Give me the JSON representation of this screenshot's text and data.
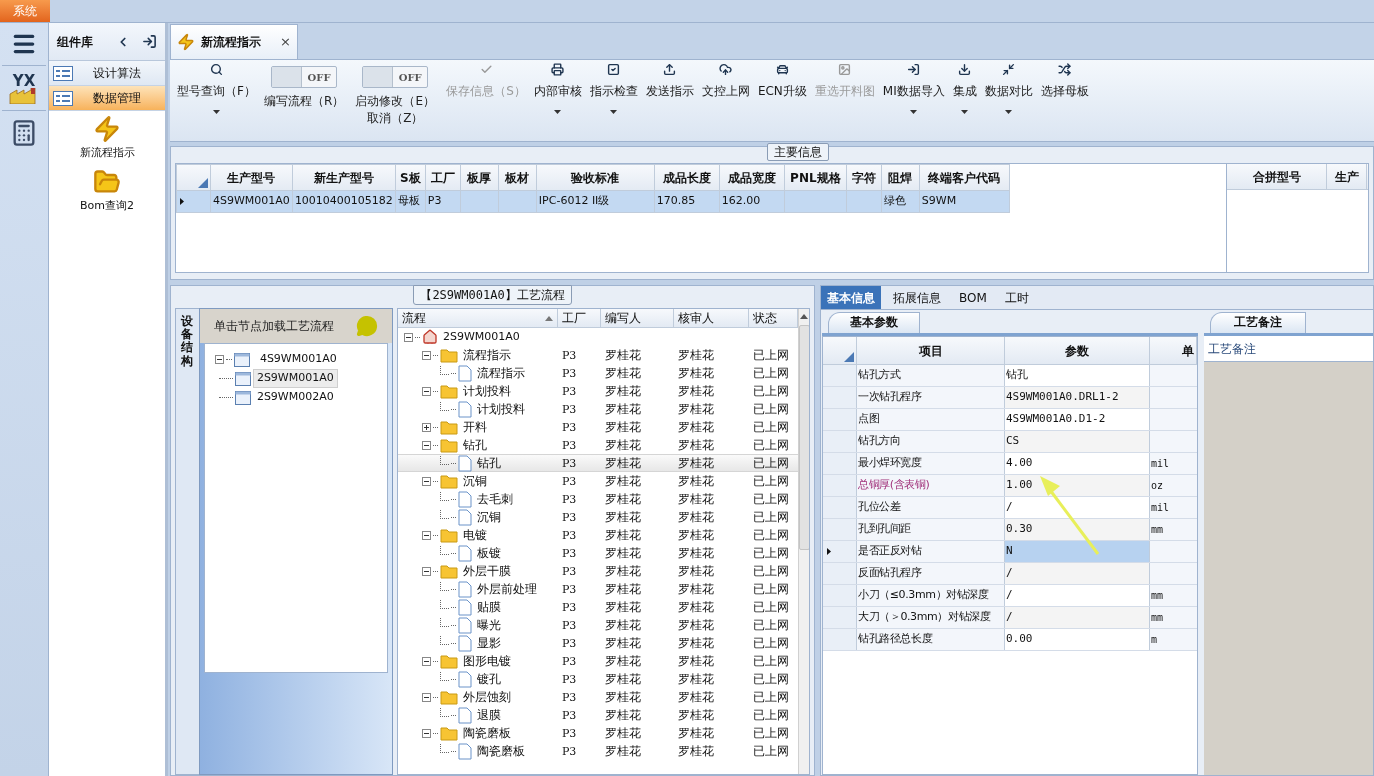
{
  "system_menu": "系统",
  "app_logo": "YX",
  "component_panel": {
    "title": "组件库",
    "items": [
      {
        "label": "设计算法",
        "selected": false
      },
      {
        "label": "数据管理",
        "selected": true
      }
    ],
    "tools": [
      {
        "label": "新流程指示",
        "kind": "lightning"
      },
      {
        "label": "Bom查询2",
        "kind": "folder"
      }
    ]
  },
  "document_tab": {
    "title": "新流程指示",
    "close": "×"
  },
  "toolbar": [
    {
      "kind": "button",
      "label": "型号查询（F）",
      "dropdown": true,
      "disabled": false
    },
    {
      "kind": "toggle",
      "label": "编写流程（R）",
      "switch_text": "OFF",
      "on": false
    },
    {
      "kind": "toggle",
      "label": "启动修改（E）取消（Z）",
      "switch_text": "OFF",
      "on": false
    },
    {
      "kind": "button",
      "label": "保存信息（S）",
      "dropdown": false,
      "disabled": true
    },
    {
      "kind": "button",
      "label": "内部审核",
      "dropdown": true,
      "disabled": false
    },
    {
      "kind": "button",
      "label": "指示检查",
      "dropdown": true,
      "disabled": false
    },
    {
      "kind": "button",
      "label": "发送指示",
      "dropdown": false,
      "disabled": false
    },
    {
      "kind": "button",
      "label": "文控上网",
      "dropdown": false,
      "disabled": false
    },
    {
      "kind": "button",
      "label": "ECN升级",
      "dropdown": false,
      "disabled": false
    },
    {
      "kind": "button",
      "label": "重选开料图",
      "dropdown": false,
      "disabled": true
    },
    {
      "kind": "button",
      "label": "MI数据导入",
      "dropdown": true,
      "disabled": false
    },
    {
      "kind": "button",
      "label": "集成",
      "dropdown": true,
      "disabled": false
    },
    {
      "kind": "button",
      "label": "数据对比",
      "dropdown": true,
      "disabled": false
    },
    {
      "kind": "button",
      "label": "选择母板",
      "dropdown": false,
      "disabled": false
    }
  ],
  "main_info": {
    "title": "主要信息",
    "columns": [
      "生产型号",
      "新生产型号",
      "S板",
      "工厂",
      "板厚",
      "板材",
      "验收标准",
      "成品长度",
      "成品宽度",
      "PNL规格",
      "字符",
      "阻焊",
      "终端客户代码"
    ],
    "rows": [
      {
        "selected": true,
        "cells": [
          "4S9WM001A0",
          "10010400105182",
          "母板",
          "P3",
          null,
          null,
          "IPC-6012 II级",
          "170.85",
          "162.00",
          null,
          null,
          "绿色",
          "S9WM"
        ]
      }
    ],
    "side_columns": [
      "合拼型号",
      "生产"
    ]
  },
  "process": {
    "title": "【2S9WM001A0】工艺流程",
    "side_tab": "设备结构",
    "hint": "单击节点加载工艺流程",
    "structure": [
      {
        "label": "4S9WM001A0",
        "expanded": true,
        "selected": false,
        "children": [
          {
            "label": "2S9WM001A0",
            "selected": true
          },
          {
            "label": "2S9WM002A0",
            "selected": false
          }
        ]
      }
    ],
    "columns": [
      "流程",
      "工厂",
      "编写人",
      "核审人",
      "状态"
    ],
    "tree": [
      {
        "label": "2S9WM001A0",
        "kind": "root",
        "expanded": true,
        "selected": false,
        "children": [
          {
            "label": "流程指示",
            "kind": "folder",
            "expanded": true,
            "selected": false,
            "factory": "P3",
            "writer": "罗桂花",
            "reviewer": "罗桂花",
            "status": "已上网",
            "children": [
              {
                "label": "流程指示",
                "kind": "file",
                "selected": false,
                "factory": "P3",
                "writer": "罗桂花",
                "reviewer": "罗桂花",
                "status": "已上网"
              }
            ]
          },
          {
            "label": "计划投料",
            "kind": "folder",
            "expanded": true,
            "selected": false,
            "factory": "P3",
            "writer": "罗桂花",
            "reviewer": "罗桂花",
            "status": "已上网",
            "children": [
              {
                "label": "计划投料",
                "kind": "file",
                "selected": false,
                "factory": "P3",
                "writer": "罗桂花",
                "reviewer": "罗桂花",
                "status": "已上网"
              }
            ]
          },
          {
            "label": "开料",
            "kind": "folder",
            "expanded": false,
            "selected": false,
            "factory": "P3",
            "writer": "罗桂花",
            "reviewer": "罗桂花",
            "status": "已上网"
          },
          {
            "label": "钻孔",
            "kind": "folder",
            "expanded": true,
            "selected": false,
            "factory": "P3",
            "writer": "罗桂花",
            "reviewer": "罗桂花",
            "status": "已上网",
            "children": [
              {
                "label": "钻孔",
                "kind": "file",
                "selected": true,
                "factory": "P3",
                "writer": "罗桂花",
                "reviewer": "罗桂花",
                "status": "已上网"
              }
            ]
          },
          {
            "label": "沉铜",
            "kind": "folder",
            "expanded": true,
            "selected": false,
            "factory": "P3",
            "writer": "罗桂花",
            "reviewer": "罗桂花",
            "status": "已上网",
            "children": [
              {
                "label": "去毛刺",
                "kind": "file",
                "selected": false,
                "factory": "P3",
                "writer": "罗桂花",
                "reviewer": "罗桂花",
                "status": "已上网"
              },
              {
                "label": "沉铜",
                "kind": "file",
                "selected": false,
                "factory": "P3",
                "writer": "罗桂花",
                "reviewer": "罗桂花",
                "status": "已上网"
              }
            ]
          },
          {
            "label": "电镀",
            "kind": "folder",
            "expanded": true,
            "selected": false,
            "factory": "P3",
            "writer": "罗桂花",
            "reviewer": "罗桂花",
            "status": "已上网",
            "children": [
              {
                "label": "板镀",
                "kind": "file",
                "selected": false,
                "factory": "P3",
                "writer": "罗桂花",
                "reviewer": "罗桂花",
                "status": "已上网"
              }
            ]
          },
          {
            "label": "外层干膜",
            "kind": "folder",
            "expanded": true,
            "selected": false,
            "factory": "P3",
            "writer": "罗桂花",
            "reviewer": "罗桂花",
            "status": "已上网",
            "children": [
              {
                "label": "外层前处理",
                "kind": "file",
                "selected": false,
                "factory": "P3",
                "writer": "罗桂花",
                "reviewer": "罗桂花",
                "status": "已上网"
              },
              {
                "label": "贴膜",
                "kind": "file",
                "selected": false,
                "factory": "P3",
                "writer": "罗桂花",
                "reviewer": "罗桂花",
                "status": "已上网"
              },
              {
                "label": "曝光",
                "kind": "file",
                "selected": false,
                "factory": "P3",
                "writer": "罗桂花",
                "reviewer": "罗桂花",
                "status": "已上网"
              },
              {
                "label": "显影",
                "kind": "file",
                "selected": false,
                "factory": "P3",
                "writer": "罗桂花",
                "reviewer": "罗桂花",
                "status": "已上网"
              }
            ]
          },
          {
            "label": "图形电镀",
            "kind": "folder",
            "expanded": true,
            "selected": false,
            "factory": "P3",
            "writer": "罗桂花",
            "reviewer": "罗桂花",
            "status": "已上网",
            "children": [
              {
                "label": "镀孔",
                "kind": "file",
                "selected": false,
                "factory": "P3",
                "writer": "罗桂花",
                "reviewer": "罗桂花",
                "status": "已上网"
              }
            ]
          },
          {
            "label": "外层蚀刻",
            "kind": "folder",
            "expanded": true,
            "selected": false,
            "factory": "P3",
            "writer": "罗桂花",
            "reviewer": "罗桂花",
            "status": "已上网",
            "children": [
              {
                "label": "退膜",
                "kind": "file",
                "selected": false,
                "factory": "P3",
                "writer": "罗桂花",
                "reviewer": "罗桂花",
                "status": "已上网"
              }
            ]
          },
          {
            "label": "陶瓷磨板",
            "kind": "folder",
            "expanded": true,
            "selected": false,
            "factory": "P3",
            "writer": "罗桂花",
            "reviewer": "罗桂花",
            "status": "已上网",
            "children": [
              {
                "label": "陶瓷磨板",
                "kind": "file",
                "selected": false,
                "factory": "P3",
                "writer": "罗桂花",
                "reviewer": "罗桂花",
                "status": "已上网"
              }
            ]
          }
        ]
      }
    ]
  },
  "detail_tabs": [
    {
      "label": "基本信息",
      "selected": true
    },
    {
      "label": "拓展信息",
      "selected": false
    },
    {
      "label": "BOM",
      "selected": false
    },
    {
      "label": "工时",
      "selected": false
    }
  ],
  "params": {
    "title": "基本参数",
    "columns": [
      "项目",
      "参数",
      "单"
    ],
    "rows": [
      {
        "item": "钻孔方式",
        "value": "钻孔",
        "emphasized": false,
        "selected": false
      },
      {
        "item": "一次钻孔程序",
        "value": "4S9WM001A0.DRL1-2",
        "emphasized": false,
        "selected": false
      },
      {
        "item": "点图",
        "value": "4S9WM001A0.D1-2",
        "emphasized": false,
        "selected": false
      },
      {
        "item": "钻孔方向",
        "value": "CS",
        "emphasized": false,
        "selected": false
      },
      {
        "item": "最小焊环宽度",
        "value": "4.00",
        "unit": "mil",
        "emphasized": false,
        "selected": false
      },
      {
        "item": "总铜厚(含表铜)",
        "value": "1.00",
        "unit": "oz",
        "emphasized": true,
        "selected": false
      },
      {
        "item": "孔位公差",
        "value": "/",
        "unit": "mil",
        "emphasized": false,
        "selected": false
      },
      {
        "item": "孔到孔间距",
        "value": "0.30",
        "unit": "mm",
        "emphasized": false,
        "selected": false
      },
      {
        "item": "是否正反对钻",
        "value": "N",
        "emphasized": false,
        "selected": true
      },
      {
        "item": "反面钻孔程序",
        "value": "/",
        "emphasized": false,
        "selected": false
      },
      {
        "item": "小刀（≤0.3mm）对钻深度",
        "value": "/",
        "unit": "mm",
        "emphasized": false,
        "selected": false
      },
      {
        "item": "大刀（＞0.3mm）对钻深度",
        "value": "/",
        "unit": "mm",
        "emphasized": false,
        "selected": false
      },
      {
        "item": "钻孔路径总长度",
        "value": "0.00",
        "unit": "m",
        "emphasized": false,
        "selected": false
      }
    ]
  },
  "notes": {
    "title": "工艺备注",
    "label": "工艺备注"
  }
}
